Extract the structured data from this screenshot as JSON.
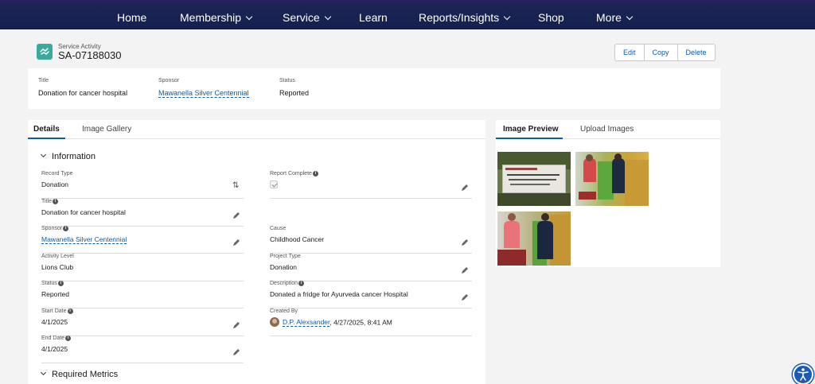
{
  "nav": {
    "items": [
      {
        "label": "Home",
        "dropdown": false
      },
      {
        "label": "Membership",
        "dropdown": true
      },
      {
        "label": "Service",
        "dropdown": true
      },
      {
        "label": "Learn",
        "dropdown": false
      },
      {
        "label": "Reports/Insights",
        "dropdown": true
      },
      {
        "label": "Shop",
        "dropdown": false
      },
      {
        "label": "More",
        "dropdown": true
      }
    ]
  },
  "record": {
    "object_label": "Service Activity",
    "name": "SA-07188030",
    "icon": "service-activity-icon",
    "actions": [
      "Edit",
      "Copy",
      "Delete"
    ]
  },
  "highlights": {
    "title_label": "Title",
    "title_value": "Donation for cancer hospital",
    "sponsor_label": "Sponsor",
    "sponsor_value": "Mawanella Silver Centennial",
    "status_label": "Status",
    "status_value": "Reported"
  },
  "left_tabs": [
    "Details",
    "Image Gallery"
  ],
  "sections": {
    "information": "Information",
    "required_metrics": "Required Metrics"
  },
  "fields": {
    "record_type": {
      "label": "Record Type",
      "value": "Donation"
    },
    "report_complete": {
      "label": "Report Complete",
      "checked": true
    },
    "title": {
      "label": "Title",
      "value": "Donation for cancer hospital"
    },
    "sponsor": {
      "label": "Sponsor",
      "value": "Mawanella Silver Centennial"
    },
    "cause": {
      "label": "Cause",
      "value": "Childhood Cancer"
    },
    "activity_level": {
      "label": "Activity Level",
      "value": "Lions Club"
    },
    "project_type": {
      "label": "Project Type",
      "value": "Donation"
    },
    "status": {
      "label": "Status",
      "value": "Reported"
    },
    "description": {
      "label": "Description",
      "value": "Donated a fridge for Ayurveda cancer Hospital"
    },
    "start_date": {
      "label": "Start Date",
      "value": "4/1/2025"
    },
    "created_by": {
      "label": "Created By",
      "user": "D.P. Alexsander",
      "timestamp": ", 4/27/2025, 8:41 AM"
    },
    "end_date": {
      "label": "End Date",
      "value": "4/1/2025"
    }
  },
  "right_tabs": [
    "Image Preview",
    "Upload Images"
  ],
  "colors": {
    "nav_bg": "#1c2656",
    "brand_link": "#0b5cab",
    "record_icon": "#3ba99c",
    "accessibility_button": "#1a5ab8"
  }
}
